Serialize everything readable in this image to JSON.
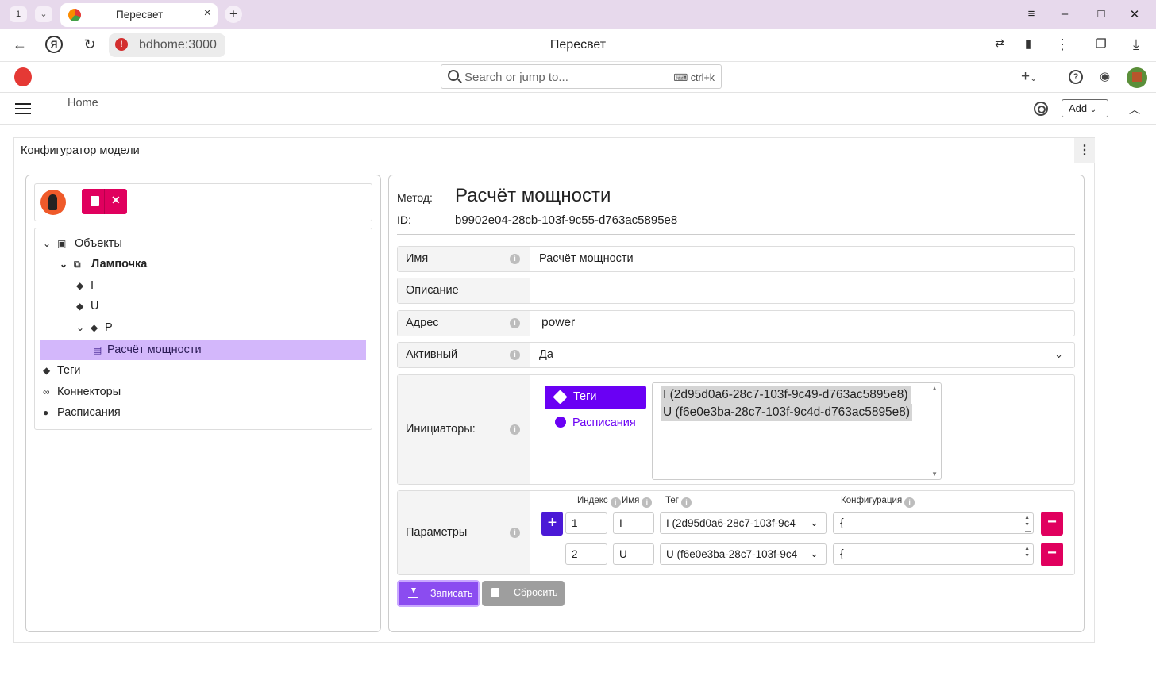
{
  "browser": {
    "tab_count": "1",
    "tab_title": "Пересвет",
    "url": "bdhome:3000",
    "page_title": "Пересвет"
  },
  "header": {
    "search_placeholder": "Search or jump to...",
    "search_shortcut": "ctrl+k"
  },
  "subheader": {
    "breadcrumb": "Home",
    "add_label": "Add"
  },
  "widget": {
    "title": "Конфигуратор модели"
  },
  "tree": {
    "objects": "Объекты",
    "lamp": "Лампочка",
    "tag_i": "I",
    "tag_u": "U",
    "tag_p": "P",
    "method": "Расчёт мощности",
    "tags": "Теги",
    "connectors": "Коннекторы",
    "schedules": "Расписания"
  },
  "method": {
    "method_label": "Метод:",
    "title": "Расчёт мощности",
    "id_label": "ID:",
    "id": "b9902e04-28cb-103f-9c55-d763ac5895e8"
  },
  "form": {
    "name_label": "Имя",
    "name_value": "Расчёт мощности",
    "desc_label": "Описание",
    "desc_value": "",
    "address_label": "Адрес",
    "address_value": "power",
    "active_label": "Активный",
    "active_value": "Да",
    "initiators_label": "Инициаторы:",
    "initiators_tags_btn": "Теги",
    "initiators_schedules_link": "Расписания",
    "initiator_options": [
      "I (2d95d0a6-28c7-103f-9c49-d763ac5895e8)",
      "U (f6e0e3ba-28c7-103f-9c4d-d763ac5895e8)"
    ],
    "params_label": "Параметры",
    "params_headers": {
      "index": "Индекс",
      "name": "Имя",
      "tag": "Тег",
      "config": "Конфигурация"
    },
    "params": [
      {
        "index": "1",
        "name": "I",
        "tag": "I (2d95d0a6-28c7-103f-9c4",
        "config": "{"
      },
      {
        "index": "2",
        "name": "U",
        "tag": "U (f6e0e3ba-28c7-103f-9c4",
        "config": "{"
      }
    ],
    "save_label": "Записать",
    "reset_label": "Сбросить"
  }
}
